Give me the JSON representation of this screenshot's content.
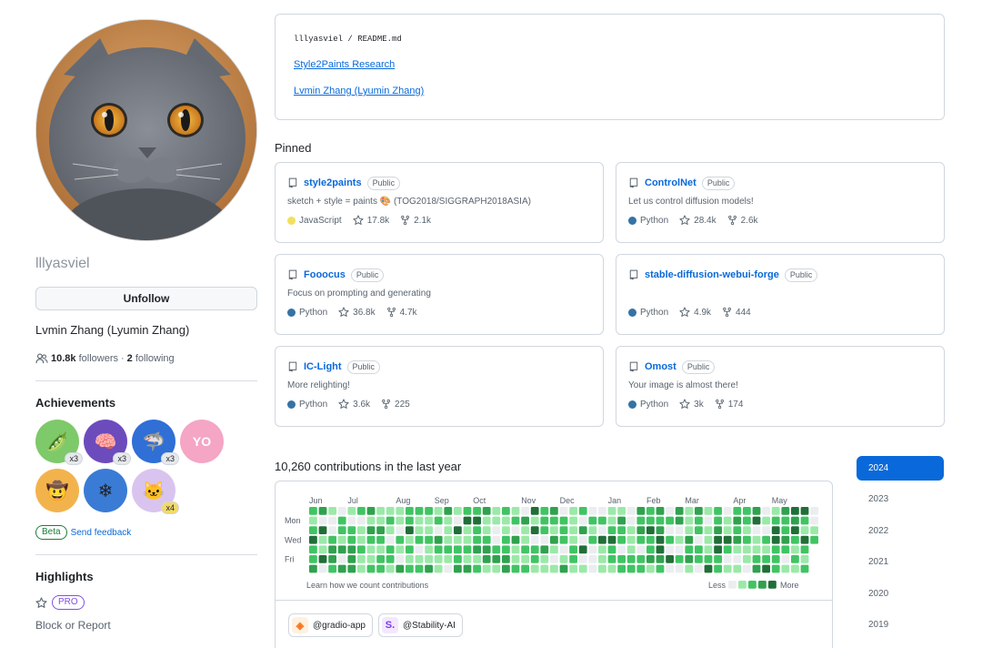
{
  "profile": {
    "username": "lllyasviel",
    "follow_button": "Unfollow",
    "fullname": "Lvmin Zhang (Lyumin Zhang)",
    "followers_count": "10.8k",
    "followers_label": "followers",
    "separator": "·",
    "following_count": "2",
    "following_label": "following"
  },
  "achievements": {
    "title": "Achievements",
    "badges": [
      {
        "icon": "pair-extraordinaire-icon",
        "count": "x3",
        "color": "#7ec96a"
      },
      {
        "icon": "galaxy-brain-icon",
        "count": "x3",
        "color": "#6c4bbd"
      },
      {
        "icon": "pull-shark-icon",
        "count": "x3",
        "color": "#2f6fd6"
      },
      {
        "icon": "yolo-icon",
        "count": "",
        "color": "#f4a6c4"
      },
      {
        "icon": "starstruck-icon",
        "count": "",
        "color": "#f3b34c"
      },
      {
        "icon": "arctic-code-vault-icon",
        "count": "",
        "color": "#3a7bd5"
      },
      {
        "icon": "quickdraw-icon",
        "count": "x4",
        "color": "#d9c4ef"
      }
    ],
    "beta_label": "Beta",
    "feedback_label": "Send feedback"
  },
  "highlights": {
    "title": "Highlights",
    "pro_label": "PRO",
    "block_label": "Block or Report"
  },
  "readme": {
    "path_user": "lllyasviel",
    "path_sep": " / ",
    "path_file": "README.md",
    "link1": "Style2Paints Research",
    "link2": "Lvmin Zhang (Lyumin Zhang)"
  },
  "pinned": {
    "title": "Pinned",
    "public_label": "Public",
    "repos": [
      {
        "name": "style2paints",
        "desc": "sketch + style = paints 🎨 (TOG2018/SIGGRAPH2018ASIA)",
        "lang": "JavaScript",
        "lang_color": "#f1e05a",
        "stars": "17.8k",
        "forks": "2.1k"
      },
      {
        "name": "ControlNet",
        "desc": "Let us control diffusion models!",
        "lang": "Python",
        "lang_color": "#3572A5",
        "stars": "28.4k",
        "forks": "2.6k"
      },
      {
        "name": "Fooocus",
        "desc": "Focus on prompting and generating",
        "lang": "Python",
        "lang_color": "#3572A5",
        "stars": "36.8k",
        "forks": "4.7k"
      },
      {
        "name": "stable-diffusion-webui-forge",
        "desc": "",
        "lang": "Python",
        "lang_color": "#3572A5",
        "stars": "4.9k",
        "forks": "444"
      },
      {
        "name": "IC-Light",
        "desc": "More relighting!",
        "lang": "Python",
        "lang_color": "#3572A5",
        "stars": "3.6k",
        "forks": "225"
      },
      {
        "name": "Omost",
        "desc": "Your image is almost there!",
        "lang": "Python",
        "lang_color": "#3572A5",
        "stars": "3k",
        "forks": "174"
      }
    ]
  },
  "contributions": {
    "title": "10,260 contributions in the last year",
    "months": [
      "Jun",
      "Jul",
      "Aug",
      "Sep",
      "Oct",
      "Nov",
      "Dec",
      "Jan",
      "Feb",
      "Mar",
      "Apr",
      "May"
    ],
    "days": [
      "Mon",
      "Wed",
      "Fri"
    ],
    "learn_label": "Learn how we count contributions",
    "less_label": "Less",
    "more_label": "More",
    "level_colors": [
      "#ebedf0",
      "#9be9a8",
      "#40c463",
      "#30a14e",
      "#216e39"
    ],
    "orgs": [
      {
        "name": "@gradio-app",
        "icon": "gradio-icon"
      },
      {
        "name": "@Stability-AI",
        "icon": "stability-ai-icon"
      }
    ]
  },
  "years": [
    "2024",
    "2023",
    "2022",
    "2021",
    "2020",
    "2019"
  ],
  "active_year": "2024"
}
